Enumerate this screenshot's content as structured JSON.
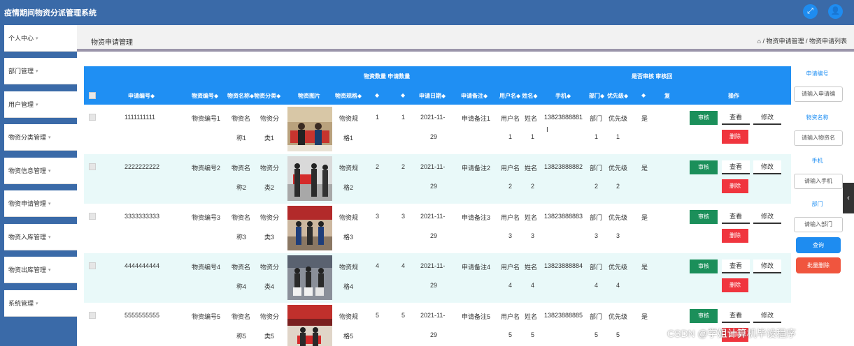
{
  "app": {
    "title": "疫情期间物资分派管理系统"
  },
  "topbar": {
    "icons": [
      "fullscreen-icon",
      "user-icon"
    ]
  },
  "sidebar": {
    "items": [
      {
        "label": "个人中心"
      },
      {
        "label": "部门管理"
      },
      {
        "label": "用户管理"
      },
      {
        "label": "物资分类管理"
      },
      {
        "label": "物资信息管理"
      },
      {
        "label": "物资申请管理"
      },
      {
        "label": "物资入库管理"
      },
      {
        "label": "物资出库管理"
      },
      {
        "label": "系统管理"
      }
    ]
  },
  "header": {
    "page_title": "物资申请管理",
    "breadcrumb": "⌂ / 物资申请管理 / 物资申请列表"
  },
  "table": {
    "headers": {
      "top_quantity": "物资数量 申请数量",
      "top_audit": "是否审核 审核回",
      "apply_no": "申请编号◆",
      "item_no": "物资编号◆",
      "item_name_cat": "物资名称◆物资分类◆",
      "item_image": "物资图片",
      "spec": "物资规格◆",
      "qty": "◆",
      "apply_qty": "◆",
      "apply_date": "申请日期◆",
      "apply_note": "申请备注◆",
      "username_name": "用户名◆ 姓名◆",
      "phone": "手机◆",
      "dept": "部门◆",
      "priority": "优先级◆",
      "is_audited": "◆",
      "reply": "复",
      "actions": "操作"
    },
    "rows": [
      {
        "apply_no": "1111111111",
        "item_no": "物资编号1",
        "name_a": "物资名",
        "name_b": "称1",
        "cat_a": "物资分",
        "cat_b": "类1",
        "spec_a": "物资规",
        "spec_b": "格1",
        "qty": "1",
        "apply_qty": "1",
        "date_a": "2021-11-",
        "date_b": "29",
        "note": "申请备注1",
        "user_a": "用户名",
        "user_b": "1",
        "name2_a": "姓名",
        "name2_b": "1",
        "phone": "13823888881",
        "dept_a": "部门",
        "dept_b": "1",
        "prio_a": "优先级",
        "prio_b": "1",
        "audited": "是"
      },
      {
        "apply_no": "2222222222",
        "item_no": "物资编号2",
        "name_a": "物资名",
        "name_b": "称2",
        "cat_a": "物资分",
        "cat_b": "类2",
        "spec_a": "物资规",
        "spec_b": "格2",
        "qty": "2",
        "apply_qty": "2",
        "date_a": "2021-11-",
        "date_b": "29",
        "note": "申请备注2",
        "user_a": "用户名",
        "user_b": "2",
        "name2_a": "姓名",
        "name2_b": "2",
        "phone": "13823888882",
        "dept_a": "部门",
        "dept_b": "2",
        "prio_a": "优先级",
        "prio_b": "2",
        "audited": "是"
      },
      {
        "apply_no": "3333333333",
        "item_no": "物资编号3",
        "name_a": "物资名",
        "name_b": "称3",
        "cat_a": "物资分",
        "cat_b": "类3",
        "spec_a": "物资规",
        "spec_b": "格3",
        "qty": "3",
        "apply_qty": "3",
        "date_a": "2021-11-",
        "date_b": "29",
        "note": "申请备注3",
        "user_a": "用户名",
        "user_b": "3",
        "name2_a": "姓名",
        "name2_b": "3",
        "phone": "13823888883",
        "dept_a": "部门",
        "dept_b": "3",
        "prio_a": "优先级",
        "prio_b": "3",
        "audited": "是"
      },
      {
        "apply_no": "4444444444",
        "item_no": "物资编号4",
        "name_a": "物资名",
        "name_b": "称4",
        "cat_a": "物资分",
        "cat_b": "类4",
        "spec_a": "物资规",
        "spec_b": "格4",
        "qty": "4",
        "apply_qty": "4",
        "date_a": "2021-11-",
        "date_b": "29",
        "note": "申请备注4",
        "user_a": "用户名",
        "user_b": "4",
        "name2_a": "姓名",
        "name2_b": "4",
        "phone": "13823888884",
        "dept_a": "部门",
        "dept_b": "4",
        "prio_a": "优先级",
        "prio_b": "4",
        "audited": "是"
      },
      {
        "apply_no": "5555555555",
        "item_no": "物资编号5",
        "name_a": "物资名",
        "name_b": "称5",
        "cat_a": "物资分",
        "cat_b": "类5",
        "spec_a": "物资规",
        "spec_b": "格5",
        "qty": "5",
        "apply_qty": "5",
        "date_a": "2021-11-",
        "date_b": "29",
        "note": "申请备注5",
        "user_a": "用户名",
        "user_b": "5",
        "name2_a": "姓名",
        "name2_b": "5",
        "phone": "13823888885",
        "dept_a": "部门",
        "dept_b": "5",
        "prio_a": "优先级",
        "prio_b": "5",
        "audited": "是"
      }
    ],
    "row_actions": {
      "audit": "审核",
      "view": "查看",
      "edit": "修改",
      "delete": "删除"
    }
  },
  "search": {
    "apply_no_label": "申请编号",
    "apply_no_placeholder": "请输入申请编",
    "item_name_label": "物资名称",
    "item_name_placeholder": "请输入物资名",
    "phone_label": "手机",
    "phone_placeholder": "请输入手机",
    "dept_label": "部门",
    "dept_placeholder": "请输入部门",
    "query_button": "查询",
    "batch_delete_button": "批量删除"
  },
  "watermark": "CSDN @学姐计算机毕设程序",
  "colors": {
    "topbar": "#3a6aa8",
    "table_header": "#1f8ff3",
    "audit_button": "#1b8f5a",
    "delete_button": "#f0353e",
    "query_button": "#1e8cf0",
    "batch_delete": "#f0553e"
  }
}
